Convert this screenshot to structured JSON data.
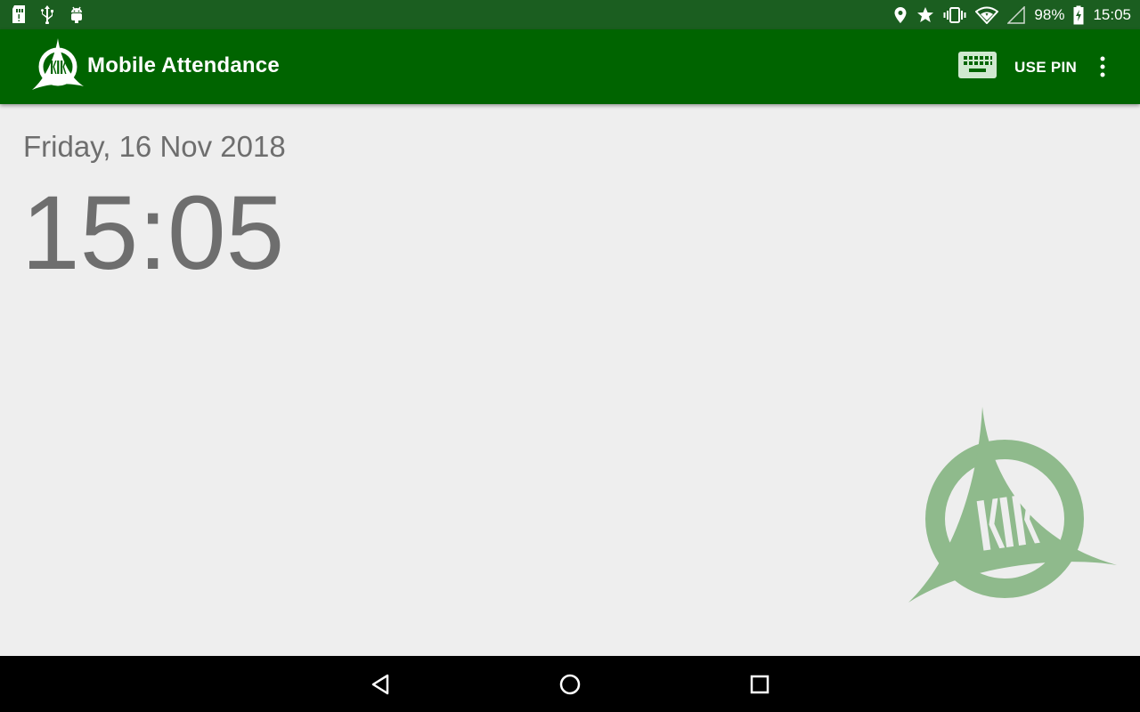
{
  "status_bar": {
    "left_icons": [
      "sd-card-icon",
      "usb-icon",
      "android-debug-icon"
    ],
    "right_icons": [
      "location-icon",
      "star-icon",
      "vibrate-icon",
      "wifi-icon",
      "signal-icon"
    ],
    "battery_percent": "98%",
    "clock": "15:05"
  },
  "app_bar": {
    "title": "Mobile Attendance",
    "use_pin_label": "USE PIN",
    "keyboard_icon": "keyboard-icon",
    "overflow_icon": "more-vert-icon",
    "logo_text": "KLK"
  },
  "main": {
    "date": "Friday, 16 Nov 2018",
    "time": "15:05"
  },
  "nav_bar": {
    "buttons": [
      "back-icon",
      "home-icon",
      "recents-icon"
    ]
  },
  "colors": {
    "status_bar": "#1b5e20",
    "app_bar": "#006400",
    "background": "#eeeeee",
    "text_gray": "#6e6e6e",
    "watermark": "#8fba8c"
  }
}
